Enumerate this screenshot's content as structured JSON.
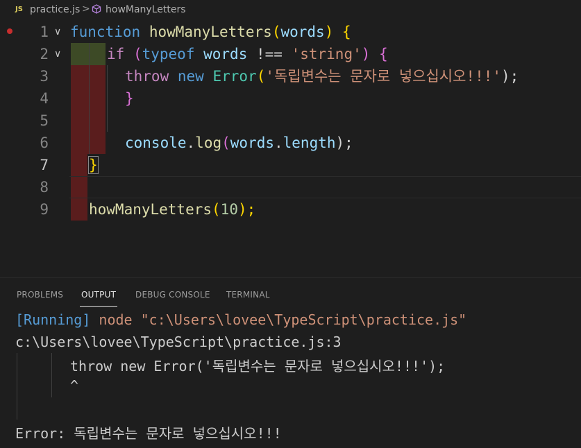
{
  "breadcrumb": {
    "lang_badge": "JS",
    "file": "practice.js",
    "separator": ">",
    "symbol": "howManyLetters"
  },
  "editor": {
    "line_numbers": [
      "1",
      "2",
      "3",
      "4",
      "5",
      "6",
      "7",
      "8",
      "9"
    ],
    "fold_glyph": "∨",
    "tokens": {
      "l1_function": "function",
      "l1_name": "howManyLetters",
      "l1_open": "(",
      "l1_param": "words",
      "l1_close": ")",
      "l1_brace": "{",
      "l2_if": "if",
      "l2_open": "(",
      "l2_typeof": "typeof",
      "l2_words": "words",
      "l2_op": "!==",
      "l2_str": "'string'",
      "l2_close": ")",
      "l2_brace": "{",
      "l3_throw": "throw",
      "l3_new": "new",
      "l3_error": "Error",
      "l3_open": "(",
      "l3_str": "'독립변수는 문자로 넣으십시오!!!'",
      "l3_close": ");",
      "l4_brace": "}",
      "l6_console": "console",
      "l6_dot1": ".",
      "l6_log": "log",
      "l6_open": "(",
      "l6_words": "words",
      "l6_dot2": ".",
      "l6_length": "length",
      "l6_close": ");",
      "l7_brace": "}",
      "l9_name": "howManyLetters",
      "l9_open": "(",
      "l9_num": "10",
      "l9_close": ");"
    }
  },
  "panel": {
    "tabs": [
      "PROBLEMS",
      "OUTPUT",
      "DEBUG CONSOLE",
      "TERMINAL"
    ],
    "active_tab": "OUTPUT",
    "output": {
      "running_tag": "[Running]",
      "running_cmd": "node \"c:\\Users\\lovee\\TypeScript\\practice.js\"",
      "path_line": "c:\\Users\\lovee\\TypeScript\\practice.js:3",
      "code_line": "throw new Error('독립변수는 문자로 넣으십시오!!!');",
      "caret_line": "^",
      "error_line": "Error: 독립변수는 문자로 넣으십시오!!!"
    }
  }
}
